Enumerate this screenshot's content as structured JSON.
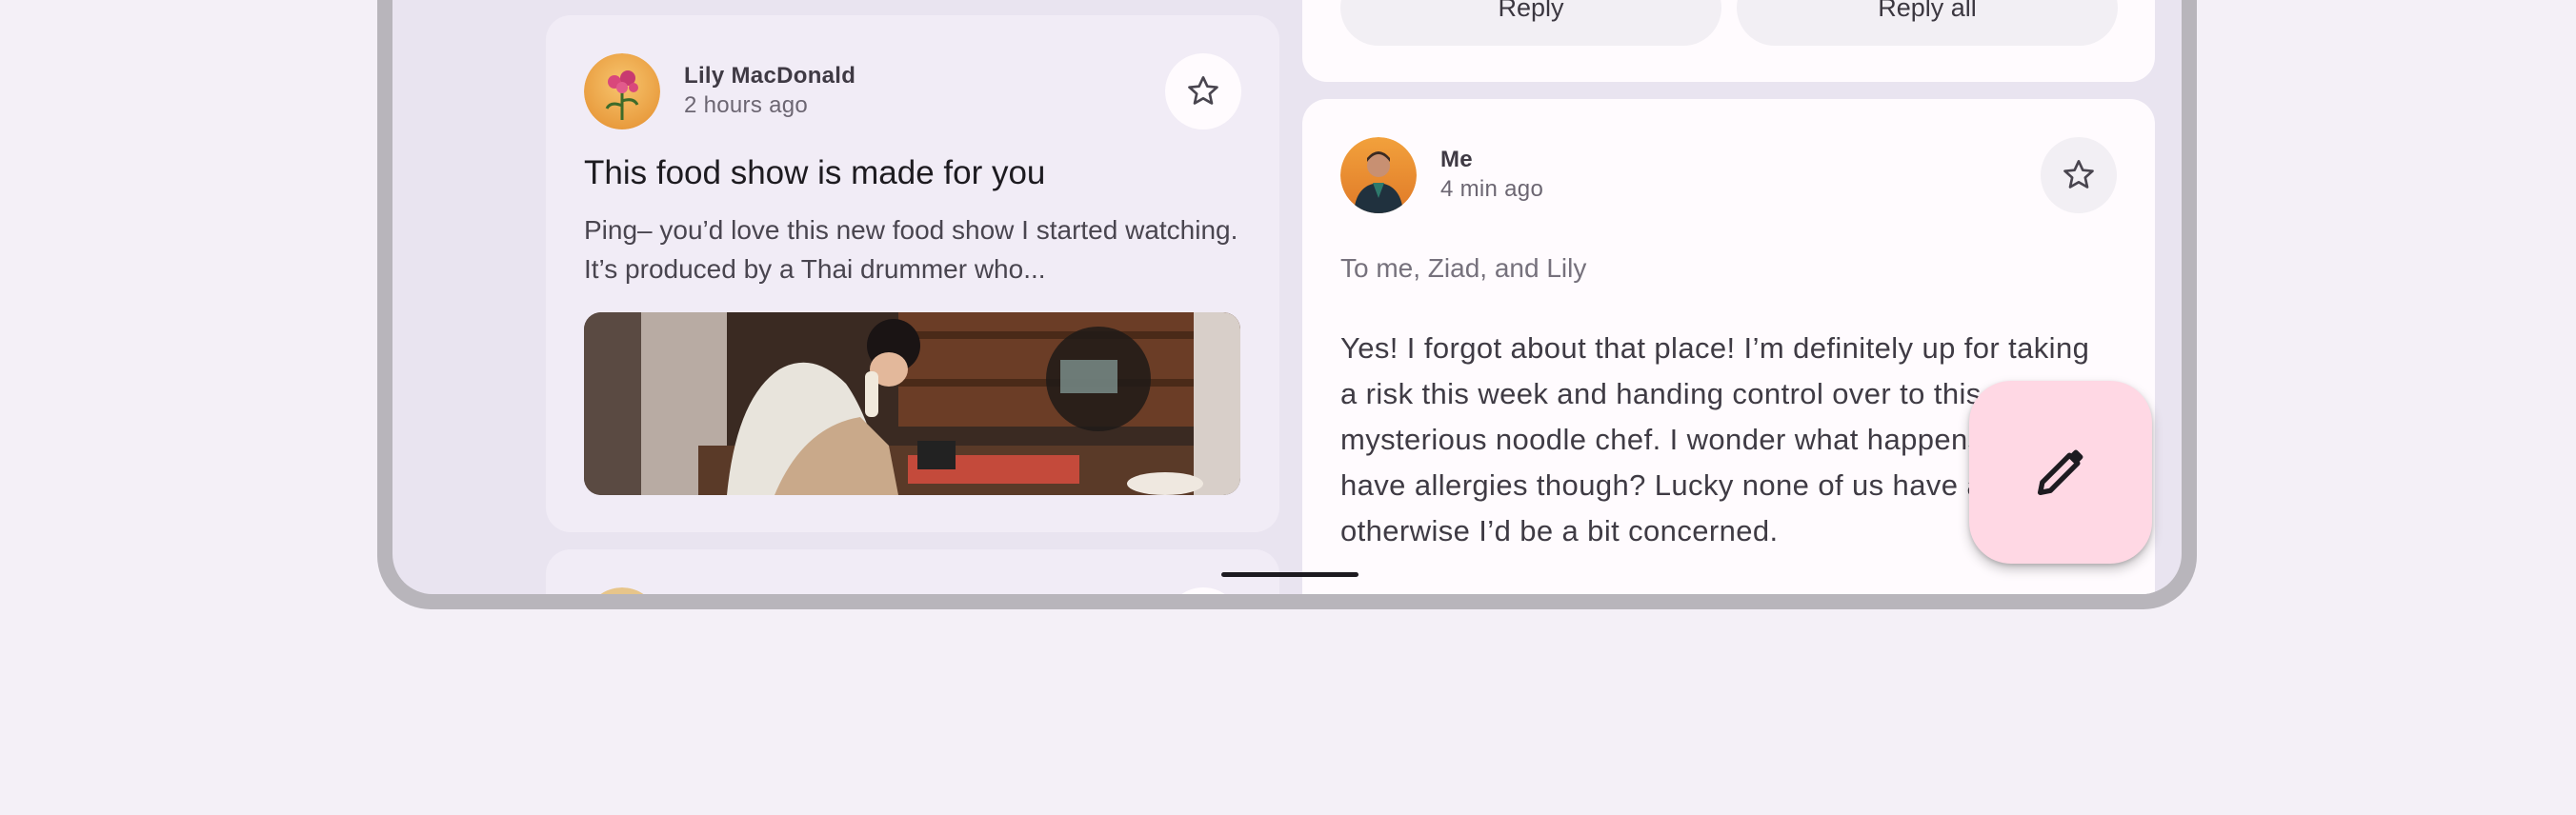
{
  "email_list": {
    "item1": {
      "sender": "Lily MacDonald",
      "time": "2 hours ago",
      "subject": "This food show is made for you",
      "preview": "Ping– you’d love this new food show I started watching. It’s produced by a Thai drummer who..."
    }
  },
  "thread": {
    "actions": {
      "reply_label": "Reply",
      "reply_all_label": "Reply all"
    },
    "message": {
      "sender": "Me",
      "time": "4 min ago",
      "recipients": "To me, Ziad, and Lily",
      "body": "Yes! I forgot about that place! I’m definitely up for taking a risk this week and handing control over to this mysterious noodle chef. I wonder what happens if you have allergies though? Lucky none of us have any otherwise I’d be a bit concerned."
    }
  },
  "icons": {
    "star": "star-outline-icon",
    "compose": "pencil-icon"
  },
  "colors": {
    "fab": "#ffd8e4",
    "list_card": "#f1ecf6",
    "detail_card": "#fffbfe"
  }
}
